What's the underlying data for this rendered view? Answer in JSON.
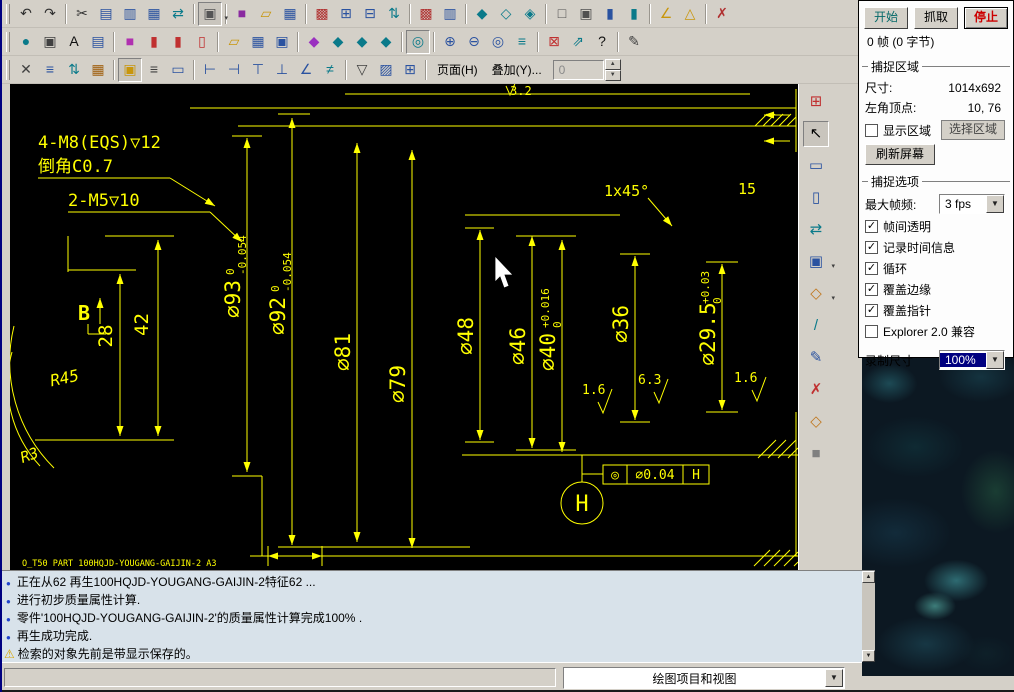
{
  "icons": {
    "bullet": "●",
    "warning": "⚠",
    "dropdown": "▼",
    "combo_small": "▾",
    "spin_up": "▲",
    "spin_down": "▼",
    "scroll_up": "▲",
    "scroll_down": "▼"
  },
  "toolbar": {
    "page_button": "页面(H)",
    "overlay_button": "叠加(Y)...",
    "page_input": "0",
    "row1": [
      {
        "grip": true
      },
      {
        "name": "undo-icon",
        "g": "↶",
        "c": "#303030"
      },
      {
        "name": "redo-icon",
        "g": "↷",
        "c": "#303030"
      },
      {
        "sep": true
      },
      {
        "name": "cut-icon",
        "g": "✂",
        "c": "#303030"
      },
      {
        "name": "copy-icon",
        "g": "▤",
        "c": "#2a52a0"
      },
      {
        "name": "paste-icon",
        "g": "▥",
        "c": "#2a52a0"
      },
      {
        "name": "paste-special-icon",
        "g": "▦",
        "c": "#2a52a0"
      },
      {
        "name": "swap-icon",
        "g": "⇄",
        "c": "#0a7a8a"
      },
      {
        "sep": true
      },
      {
        "name": "selection-box-icon",
        "g": "▣",
        "c": "#555555",
        "drop": true,
        "pressed": true
      },
      {
        "sep": true
      },
      {
        "name": "new-model-icon",
        "g": "■",
        "c": "#8a2aa0"
      },
      {
        "name": "open-icon",
        "g": "▱",
        "c": "#c8960c"
      },
      {
        "name": "save-icon",
        "g": "▦",
        "c": "#2a52a0"
      },
      {
        "sep": true
      },
      {
        "name": "table-icon",
        "g": "▩",
        "c": "#b03030"
      },
      {
        "name": "print-icon",
        "g": "⊞",
        "c": "#2a52a0"
      },
      {
        "name": "print-preview-icon",
        "g": "⊟",
        "c": "#2a52a0"
      },
      {
        "name": "link-icon",
        "g": "⇅",
        "c": "#0a7a8a"
      },
      {
        "sep": true
      },
      {
        "name": "table2-icon",
        "g": "▩",
        "c": "#b03030"
      },
      {
        "name": "clipboard-icon",
        "g": "▥",
        "c": "#2a52a0"
      },
      {
        "sep": true
      },
      {
        "name": "model-solid-icon",
        "g": "◆",
        "c": "#0a7a8a"
      },
      {
        "name": "model-wire-icon",
        "g": "◇",
        "c": "#0a7a8a"
      },
      {
        "name": "model-section-icon",
        "g": "◈",
        "c": "#0a7a8a"
      },
      {
        "sep": true
      },
      {
        "name": "view-front-icon",
        "g": "□",
        "c": "#505050"
      },
      {
        "name": "view-iso-icon",
        "g": "▣",
        "c": "#505050"
      },
      {
        "name": "bar-blue-icon",
        "g": "▮",
        "c": "#2a52a0"
      },
      {
        "name": "bar-teal-icon",
        "g": "▮",
        "c": "#0a7a8a"
      },
      {
        "sep": true
      },
      {
        "name": "angle-icon",
        "g": "∠",
        "c": "#c8960c"
      },
      {
        "name": "measure-icon",
        "g": "△",
        "c": "#c8960c"
      },
      {
        "sep": true
      },
      {
        "name": "delete-icon",
        "g": "✗",
        "c": "#b03030"
      }
    ],
    "row2": [
      {
        "grip": true
      },
      {
        "name": "globe-icon",
        "g": "●",
        "c": "#0a7a8a"
      },
      {
        "name": "camera-icon",
        "g": "▣",
        "c": "#404040"
      },
      {
        "name": "annotation-icon",
        "g": "A",
        "c": "#101010"
      },
      {
        "name": "layers-icon",
        "g": "▤",
        "c": "#2a52a0"
      },
      {
        "sep": true
      },
      {
        "name": "part-magenta-icon",
        "g": "■",
        "c": "#b030b0"
      },
      {
        "name": "part-red-icon",
        "g": "▮",
        "c": "#c03030"
      },
      {
        "name": "part-red2-icon",
        "g": "▮",
        "c": "#c03030"
      },
      {
        "name": "part-red3-icon",
        "g": "▯",
        "c": "#c03030"
      },
      {
        "sep": true
      },
      {
        "name": "folder-icon",
        "g": "▱",
        "c": "#c8960c"
      },
      {
        "name": "save2-icon",
        "g": "▦",
        "c": "#2a52a0"
      },
      {
        "name": "export-icon",
        "g": "▣",
        "c": "#2a52a0"
      },
      {
        "sep": true
      },
      {
        "name": "feature1-icon",
        "g": "◆",
        "c": "#9a30c0"
      },
      {
        "name": "feature2-icon",
        "g": "◆",
        "c": "#0a7a8a"
      },
      {
        "name": "feature3-icon",
        "g": "◆",
        "c": "#0a7a8a"
      },
      {
        "name": "feature4-icon",
        "g": "◆",
        "c": "#0a7a8a"
      },
      {
        "sep": true
      },
      {
        "name": "shaded-view-icon",
        "g": "◎",
        "c": "#0a7a8a",
        "pressed": true
      },
      {
        "sep": true
      },
      {
        "name": "zoom-in-icon",
        "g": "⊕",
        "c": "#2a52a0"
      },
      {
        "name": "zoom-out-icon",
        "g": "⊖",
        "c": "#2a52a0"
      },
      {
        "name": "zoom-window-icon",
        "g": "◎",
        "c": "#2a52a0"
      },
      {
        "name": "layer-stack-icon",
        "g": "≡",
        "c": "#0a7a8a"
      },
      {
        "sep": true
      },
      {
        "name": "close-red-icon",
        "g": "⊠",
        "c": "#c03030"
      },
      {
        "name": "pointer-arrow-icon",
        "g": "⇗",
        "c": "#0a7a8a"
      },
      {
        "name": "help-icon",
        "g": "?",
        "c": "#101010"
      },
      {
        "sep": true
      },
      {
        "name": "pencil-icon",
        "g": "✎",
        "c": "#404040"
      }
    ],
    "row3": [
      {
        "grip": true
      },
      {
        "name": "close-icon",
        "g": "✕",
        "c": "#404040"
      },
      {
        "name": "list-icon",
        "g": "≡",
        "c": "#2a52a0"
      },
      {
        "name": "refresh-icon",
        "g": "⇅",
        "c": "#0a7a8a"
      },
      {
        "name": "grid-icon",
        "g": "▦",
        "c": "#a06010"
      },
      {
        "sep": true
      },
      {
        "name": "lock-icon",
        "g": "▣",
        "c": "#c8960c",
        "pressed": true
      },
      {
        "name": "lines-icon",
        "g": "≡",
        "c": "#404040"
      },
      {
        "name": "frame-icon",
        "g": "▭",
        "c": "#2a52a0"
      },
      {
        "sep": true
      },
      {
        "name": "align-left-icon",
        "g": "⊢",
        "c": "#2a52a0"
      },
      {
        "name": "align-right-icon",
        "g": "⊣",
        "c": "#2a52a0"
      },
      {
        "name": "align-top-icon",
        "g": "⊤",
        "c": "#2a52a0"
      },
      {
        "name": "align-bottom-icon",
        "g": "⊥",
        "c": "#2a52a0"
      },
      {
        "name": "angle-dim-icon",
        "g": "∠",
        "c": "#2a52a0"
      },
      {
        "name": "diff-icon",
        "g": "≠",
        "c": "#0a7a8a"
      },
      {
        "sep": true
      },
      {
        "name": "roughness-icon",
        "g": "▽",
        "c": "#404040"
      },
      {
        "name": "hatch-icon",
        "g": "▨",
        "c": "#2a52a0"
      },
      {
        "name": "tolerance-icon",
        "g": "⊞",
        "c": "#2a52a0"
      },
      {
        "sep": true
      }
    ]
  },
  "right_toolbar": [
    {
      "name": "grid-snap-icon",
      "g": "⊞",
      "c": "#c03030"
    },
    {
      "name": "select-cursor-icon",
      "g": "↖",
      "c": "#000000",
      "pressed": true
    },
    {
      "name": "rect-tool-icon",
      "g": "▭",
      "c": "#2a52a0"
    },
    {
      "name": "rect2-tool-icon",
      "g": "▯",
      "c": "#2a52a0"
    },
    {
      "name": "swap-view-icon",
      "g": "⇄",
      "c": "#0a7a8a"
    },
    {
      "name": "handles-icon",
      "g": "▣",
      "c": "#2a52a0",
      "drop": true
    },
    {
      "name": "diamond-tool-icon",
      "g": "◇",
      "c": "#c07820",
      "drop": true
    },
    {
      "name": "slant-line-icon",
      "g": "/",
      "c": "#0a7a8a"
    },
    {
      "name": "edit-icon",
      "g": "✎",
      "c": "#2a52a0"
    },
    {
      "name": "delete2-icon",
      "g": "✗",
      "c": "#c03030"
    },
    {
      "name": "diamond2-icon",
      "g": "◇",
      "c": "#c07820"
    },
    {
      "name": "swatch-icon",
      "g": "■",
      "c": "#808080"
    }
  ],
  "capture_panel": {
    "start_button": "开始",
    "grab_button": "抓取",
    "stop_button": "停止",
    "frame_info": "0 帧 (0 字节)",
    "area": {
      "title": "捕捉区域",
      "size_label": "尺寸:",
      "size_value": "1014x692",
      "corner_label": "左角顶点:",
      "corner_value": "10, 76",
      "show_area_label": "显示区域",
      "show_area_checked": false,
      "select_area_button": "选择区域",
      "refresh_button": "刷新屏幕"
    },
    "options": {
      "title": "捕捉选项",
      "fps_label": "最大帧频:",
      "fps_value": "3 fps",
      "checkboxes": [
        {
          "label": "帧间透明",
          "checked": true
        },
        {
          "label": "记录时间信息",
          "checked": true
        },
        {
          "label": "循环",
          "checked": true
        },
        {
          "label": "覆盖边缘",
          "checked": true
        },
        {
          "label": "覆盖指针",
          "checked": true
        },
        {
          "label": "Explorer 2.0 兼容",
          "checked": false
        }
      ],
      "record_size_label": "录制尺寸",
      "record_size_value": "100%"
    }
  },
  "drawing": {
    "note_m8": "4-M8(EQS)▽12",
    "note_chamfer": "倒角C0.7",
    "note_m5": "2-M5▽10",
    "view_label": "B",
    "dim_28": "28",
    "dim_42": "42",
    "r45": "R45",
    "r3": "R3",
    "chamfer_note": "1x45°",
    "dim_15": "15",
    "rough_top": "3.2",
    "rough_1": "1.6",
    "rough_2": "6.3",
    "rough_3": "1.6",
    "tol_frame": {
      "sym": "◎",
      "value": "∅0.04",
      "datum": "H"
    },
    "datum_label": "H",
    "dims": [
      {
        "label": "∅93",
        "tol_up": "0",
        "tol_dn": "-0.054"
      },
      {
        "label": "∅92",
        "tol_up": "0",
        "tol_dn": "-0.054"
      },
      {
        "label": "∅81"
      },
      {
        "label": "∅79"
      },
      {
        "label": "∅48"
      },
      {
        "label": "∅46"
      },
      {
        "label": "∅40",
        "tol_up": "+0.016",
        "tol_dn": "0"
      },
      {
        "label": "∅36"
      },
      {
        "label": "∅29.5",
        "tol_up": "+0.03",
        "tol_dn": "0"
      }
    ],
    "status_line": "O_T50   PART   100HQJD-YOUGANG-GAIJIN-2   A3"
  },
  "messages": [
    {
      "icon": "bullet",
      "text": "正在从62 再生100HQJD-YOUGANG-GAIJIN-2特征62 ..."
    },
    {
      "icon": "bullet",
      "text": "进行初步质量属性计算."
    },
    {
      "icon": "bullet",
      "text": "零件'100HQJD-YOUGANG-GAIJIN-2'的质量属性计算完成100% ."
    },
    {
      "icon": "bullet",
      "text": "再生成功完成."
    },
    {
      "icon": "warning",
      "text": "检索的对象先前是带显示保存的。"
    }
  ],
  "status_bar": {
    "combo_value": "绘图项目和视图"
  }
}
